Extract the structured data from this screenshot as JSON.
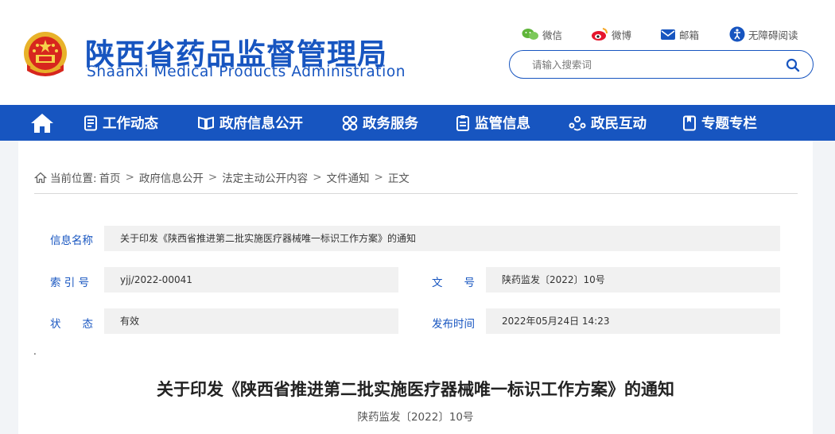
{
  "site": {
    "title_cn": "陕西省药品监督管理局",
    "title_en": "Shaanxi Medical Products Administration"
  },
  "toplinks": {
    "wechat": "微信",
    "weibo": "微博",
    "email": "邮箱",
    "accessibility": "无障碍阅读"
  },
  "search": {
    "placeholder": "请输入搜索词"
  },
  "nav": {
    "items": [
      "工作动态",
      "政府信息公开",
      "政务服务",
      "监管信息",
      "政民互动",
      "专题专栏"
    ]
  },
  "breadcrumb": {
    "prefix": "当前位置:",
    "items": [
      "首页",
      "政府信息公开",
      "法定主动公开内容",
      "文件通知",
      "正文"
    ]
  },
  "info": {
    "name_label": "信息名称",
    "name_value": "关于印发《陕西省推进第二批实施医疗器械唯一标识工作方案》的通知",
    "index_label": "索 引 号",
    "index_value": "yjj/2022-00041",
    "docno_label": "文　　号",
    "docno_value": "陕药监发〔2022〕10号",
    "status_label": "状　　态",
    "status_value": "有效",
    "date_label": "发布时间",
    "date_value": "2022年05月24日 14:23"
  },
  "doc": {
    "dot": ".",
    "title": "关于印发《陕西省推进第二批实施医疗器械唯一标识工作方案》的通知",
    "number": "陕药监发〔2022〕10号"
  },
  "colors": {
    "brand": "#1755c0",
    "nav_bg": "#1755c0",
    "field_bg": "#f1f1f1"
  },
  "icons": {
    "emblem": "national-emblem",
    "wechat": "wechat-icon",
    "weibo": "weibo-icon",
    "email": "mail-icon",
    "accessibility": "accessibility-icon",
    "search": "search-icon",
    "home": "home-icon"
  }
}
